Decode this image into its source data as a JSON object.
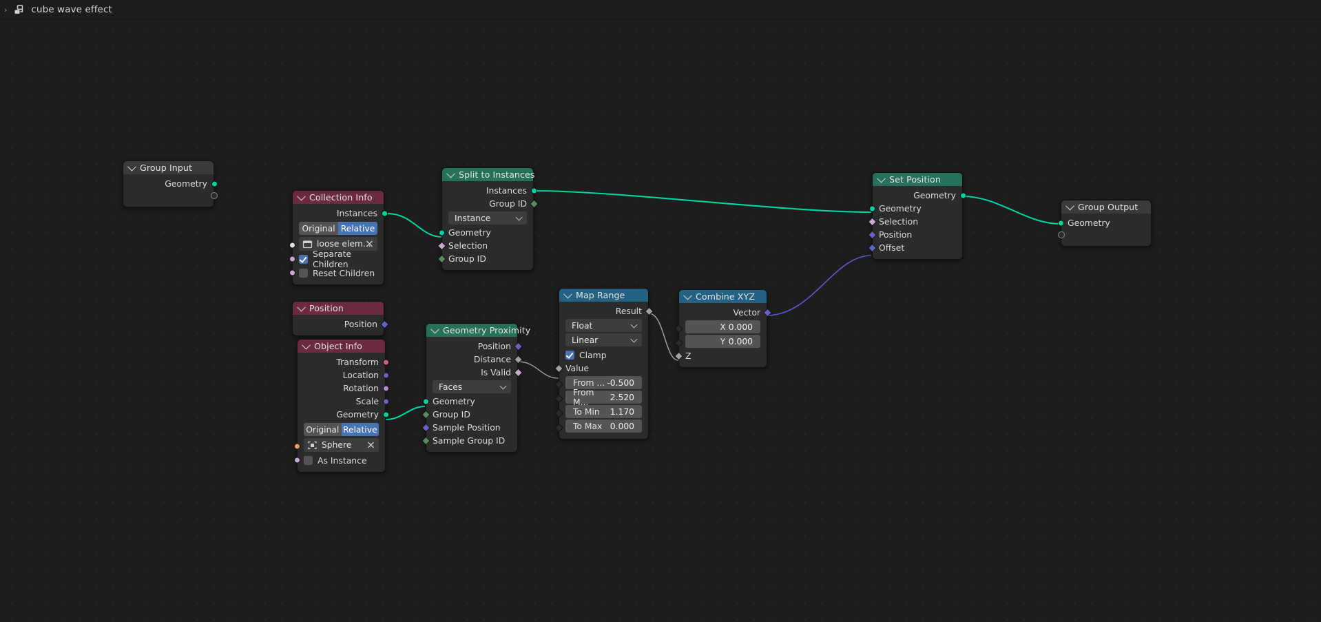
{
  "header": {
    "breadcrumb_arrow": "›",
    "icon": "geometry-nodes-icon",
    "title": "cube wave effect"
  },
  "colors": {
    "background": "#1d1d1d",
    "node_body": "#2b2b2b",
    "header_geometry": "#27705c",
    "header_input": "#6b2a42",
    "header_converter": "#246283",
    "header_collapsed": "#3a3a3a",
    "accent_blue": "#4772b3",
    "socket_geometry": "#00d6a3",
    "socket_vector": "#6363c7",
    "socket_float": "#a1a1a1",
    "socket_boolean": "#cca6d6",
    "socket_int": "#598c5c",
    "socket_object": "#ed9e5c",
    "socket_matrix": "#ca5f8d",
    "socket_rotation": "#b985d1",
    "link_geometry": "#00d6a3",
    "link_vector": "#5b5bd8",
    "link_float": "#9e9e9e"
  },
  "nodes": {
    "group_input": {
      "title": "Group Input",
      "outputs": [
        {
          "label": "Geometry",
          "type": "geometry",
          "shape": "circle"
        }
      ],
      "virtual_socket": true
    },
    "collection_info": {
      "title": "Collection Info",
      "outputs": [
        {
          "label": "Instances",
          "type": "geometry",
          "shape": "circle"
        }
      ],
      "transform_space": {
        "option_a": "Original",
        "option_b": "Relative",
        "selected": "Relative"
      },
      "collection": {
        "name": "loose elem...",
        "icon": "collection-icon",
        "clear": "×"
      },
      "separate_children": {
        "label": "Separate Children",
        "checked": true
      },
      "reset_children": {
        "label": "Reset Children",
        "checked": false
      }
    },
    "split_to_instances": {
      "title": "Split to Instances",
      "outputs": [
        {
          "label": "Instances",
          "type": "geometry",
          "shape": "circle"
        },
        {
          "label": "Group ID",
          "type": "int",
          "shape": "diamond"
        }
      ],
      "domain": "Instance",
      "inputs": [
        {
          "label": "Geometry",
          "type": "geometry",
          "shape": "circle"
        },
        {
          "label": "Selection",
          "type": "boolean",
          "shape": "diamond"
        },
        {
          "label": "Group ID",
          "type": "int",
          "shape": "diamond"
        }
      ]
    },
    "set_position": {
      "title": "Set Position",
      "outputs": [
        {
          "label": "Geometry",
          "type": "geometry",
          "shape": "circle"
        }
      ],
      "inputs": [
        {
          "label": "Geometry",
          "type": "geometry",
          "shape": "circle"
        },
        {
          "label": "Selection",
          "type": "boolean",
          "shape": "diamond"
        },
        {
          "label": "Position",
          "type": "vector",
          "shape": "diamond"
        },
        {
          "label": "Offset",
          "type": "vector",
          "shape": "diamond"
        }
      ]
    },
    "group_output": {
      "title": "Group Output",
      "inputs": [
        {
          "label": "Geometry",
          "type": "geometry",
          "shape": "circle"
        }
      ],
      "virtual_socket": true
    },
    "position": {
      "title": "Position",
      "outputs": [
        {
          "label": "Position",
          "type": "vector",
          "shape": "diamond"
        }
      ]
    },
    "object_info": {
      "title": "Object Info",
      "outputs": [
        {
          "label": "Transform",
          "type": "matrix",
          "shape": "circle"
        },
        {
          "label": "Location",
          "type": "vector",
          "shape": "circle"
        },
        {
          "label": "Rotation",
          "type": "rotation",
          "shape": "circle"
        },
        {
          "label": "Scale",
          "type": "vector",
          "shape": "circle"
        },
        {
          "label": "Geometry",
          "type": "geometry",
          "shape": "circle"
        }
      ],
      "transform_space": {
        "option_a": "Original",
        "option_b": "Relative",
        "selected": "Relative"
      },
      "object": {
        "name": "Sphere",
        "icon": "object-icon",
        "clear": "×"
      },
      "as_instance": {
        "label": "As Instance",
        "checked": false
      }
    },
    "geometry_proximity": {
      "title": "Geometry Proximity",
      "outputs": [
        {
          "label": "Position",
          "type": "vector",
          "shape": "diamond"
        },
        {
          "label": "Distance",
          "type": "float",
          "shape": "diamond"
        },
        {
          "label": "Is Valid",
          "type": "boolean",
          "shape": "diamond"
        }
      ],
      "target_element": "Faces",
      "inputs": [
        {
          "label": "Geometry",
          "type": "geometry",
          "shape": "circle"
        },
        {
          "label": "Group ID",
          "type": "int",
          "shape": "diamond"
        },
        {
          "label": "Sample Position",
          "type": "vector",
          "shape": "diamond"
        },
        {
          "label": "Sample Group ID",
          "type": "int",
          "shape": "diamond"
        }
      ]
    },
    "map_range": {
      "title": "Map Range",
      "outputs": [
        {
          "label": "Result",
          "type": "float",
          "shape": "diamond"
        }
      ],
      "data_type": "Float",
      "interpolation": "Linear",
      "clamp": {
        "label": "Clamp",
        "checked": true
      },
      "value_input": {
        "label": "Value",
        "type": "float",
        "shape": "diamond"
      },
      "fields": [
        {
          "label": "From ...",
          "value": "-0.500"
        },
        {
          "label": "From M...",
          "value": "2.520"
        },
        {
          "label": "To Min",
          "value": "1.170"
        },
        {
          "label": "To Max",
          "value": "0.000"
        }
      ]
    },
    "combine_xyz": {
      "title": "Combine XYZ",
      "outputs": [
        {
          "label": "Vector",
          "type": "vector",
          "shape": "diamond"
        }
      ],
      "fields": [
        {
          "label": "X",
          "value": "0.000"
        },
        {
          "label": "Y",
          "value": "0.000"
        }
      ],
      "z_input": {
        "label": "Z",
        "type": "vector",
        "shape": "diamond"
      }
    }
  }
}
